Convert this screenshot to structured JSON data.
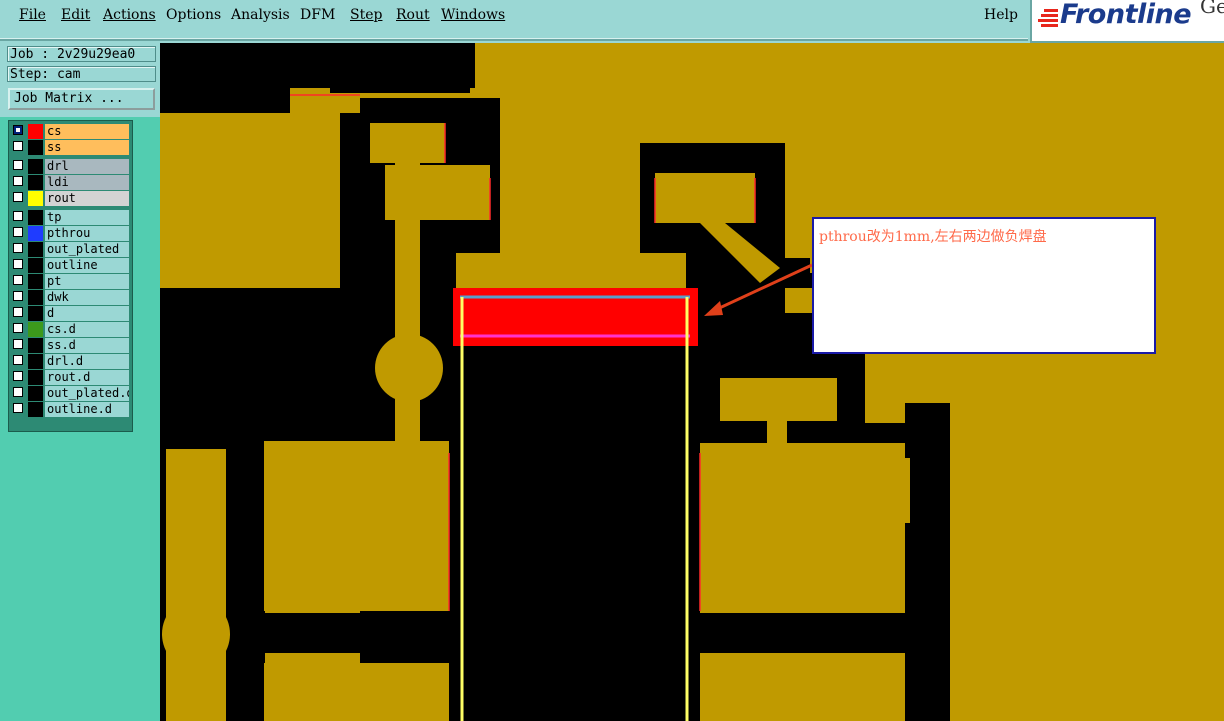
{
  "menu": {
    "items": [
      {
        "label": "File"
      },
      {
        "label": "Edit"
      },
      {
        "label": "Actions"
      },
      {
        "label": "Options"
      },
      {
        "label": "Analysis"
      },
      {
        "label": "DFM"
      },
      {
        "label": "Step"
      },
      {
        "label": "Rout"
      },
      {
        "label": "Windows"
      }
    ],
    "help": "Help"
  },
  "logo": {
    "text": "Frontline",
    "partial": "Ge"
  },
  "job": {
    "label": "Job : 2v29u29ea0",
    "step": "Step: cam",
    "matrix_button": "Job Matrix ..."
  },
  "layers": [
    {
      "name": "cs",
      "color": "#ff0000",
      "bg": "#ffbe5c",
      "active": true
    },
    {
      "name": "ss",
      "color": "#000000",
      "bg": "#ffbe5c",
      "active": false
    },
    {
      "name": "drl",
      "color": "#000000",
      "bg": "#a9b8bf",
      "active": false
    },
    {
      "name": "ldi",
      "color": "#000000",
      "bg": "#a9b8bf",
      "active": false
    },
    {
      "name": "rout",
      "color": "#ffff00",
      "bg": "#d3d3d3",
      "active": false
    },
    {
      "name": "tp",
      "color": "#000000",
      "bg": "#9ad7d4",
      "active": false
    },
    {
      "name": "pthrou",
      "color": "#1f3cff",
      "bg": "#9ad7d4",
      "active": false
    },
    {
      "name": "out_plated",
      "color": "#000000",
      "bg": "#9ad7d4",
      "active": false
    },
    {
      "name": "outline",
      "color": "#000000",
      "bg": "#9ad7d4",
      "active": false
    },
    {
      "name": "pt",
      "color": "#000000",
      "bg": "#9ad7d4",
      "active": false
    },
    {
      "name": "dwk",
      "color": "#000000",
      "bg": "#9ad7d4",
      "active": false
    },
    {
      "name": "d",
      "color": "#000000",
      "bg": "#9ad7d4",
      "active": false
    },
    {
      "name": "cs.d",
      "color": "#3c9a1c",
      "bg": "#9ad7d4",
      "active": false
    },
    {
      "name": "ss.d",
      "color": "#000000",
      "bg": "#9ad7d4",
      "active": false
    },
    {
      "name": "drl.d",
      "color": "#000000",
      "bg": "#9ad7d4",
      "active": false
    },
    {
      "name": "rout.d",
      "color": "#000000",
      "bg": "#9ad7d4",
      "active": false
    },
    {
      "name": "out_plated.d",
      "color": "#000000",
      "bg": "#9ad7d4",
      "active": false
    },
    {
      "name": "outline.d",
      "color": "#000000",
      "bg": "#9ad7d4",
      "active": false
    }
  ],
  "annotation": {
    "text": "pthrou改为1mm,左右两边做负焊盘"
  },
  "colors": {
    "copper": "#c09a00",
    "board_void": "#000000",
    "highlight_pad": "#ff0000",
    "rout_outline": "#ffff66",
    "arrow": "#e0401a"
  }
}
